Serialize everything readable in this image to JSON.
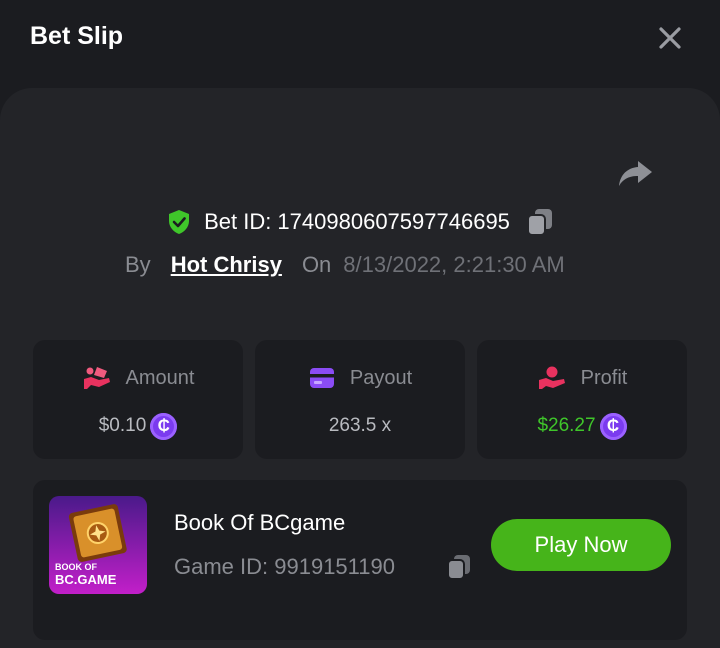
{
  "header": {
    "title": "Bet Slip"
  },
  "bet": {
    "id_label": "Bet ID: 1740980607597746695",
    "by_label": "By",
    "username": "Hot Chrisy",
    "on_label": "On",
    "date": "8/13/2022, 2:21:30 AM"
  },
  "stats": {
    "amount": {
      "label": "Amount",
      "value": "$0.10",
      "icon": "money-hand-icon"
    },
    "payout": {
      "label": "Payout",
      "value": "263.5 x",
      "icon": "card-icon"
    },
    "profit": {
      "label": "Profit",
      "value": "$26.27",
      "icon": "profit-hand-icon"
    },
    "coin_symbol": "₵"
  },
  "game": {
    "name": "Book Of BCgame",
    "id_label": "Game ID: 9919151190",
    "thumb_text_1": "BOOK OF",
    "thumb_text_2": "BC.GAME",
    "play_label": "Play Now"
  },
  "colors": {
    "accent_green": "#46b41a",
    "profit_green": "#3fc62a",
    "coin_purple": "#7b3bef",
    "background": "#1b1c20",
    "panel": "#232428"
  }
}
